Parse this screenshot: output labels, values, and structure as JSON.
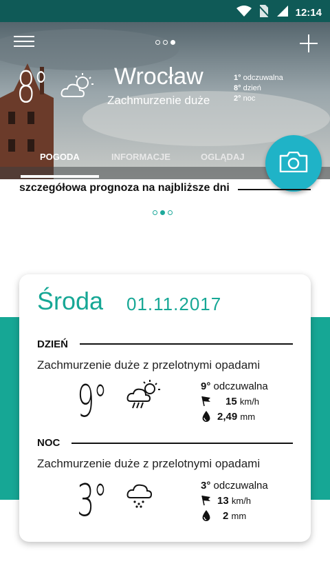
{
  "status": {
    "time": "12:14"
  },
  "header": {
    "temperature": "8°",
    "city": "Wrocław",
    "condition": "Zachmurzenie duże",
    "details": [
      {
        "value": "1°",
        "label": "odczuwalna"
      },
      {
        "value": "8°",
        "label": "dzień"
      },
      {
        "value": "2°",
        "label": "noc"
      }
    ]
  },
  "tabs": [
    {
      "label": "POGODA",
      "active": true
    },
    {
      "label": "INFORMACJE",
      "active": false
    },
    {
      "label": "OGLĄDAJ",
      "active": false
    }
  ],
  "subtitle": "szczegółowa prognoza na najbliższe dni",
  "card": {
    "day": "Środa",
    "date": "01.11.2017",
    "day_section": {
      "title": "DZIEŃ",
      "description": "Zachmurzenie duże z przelotnymi opadami",
      "temp": "9°",
      "feels_value": "9°",
      "feels_label": "odczuwalna",
      "wind_value": "15",
      "wind_unit": "km/h",
      "rain_value": "2,49",
      "rain_unit": "mm",
      "icon": "cloud-sun-rain-icon"
    },
    "night_section": {
      "title": "NOC",
      "description": "Zachmurzenie duże z przelotnymi opadami",
      "temp": "3°",
      "feels_value": "3°",
      "feels_label": "odczuwalna",
      "wind_value": "13",
      "wind_unit": "km/h",
      "rain_value": "2",
      "rain_unit": "mm",
      "icon": "cloud-rain-icon"
    }
  },
  "colors": {
    "teal": "#16a795",
    "fab": "#1fb3c7",
    "statusbar": "#0f5a57"
  }
}
